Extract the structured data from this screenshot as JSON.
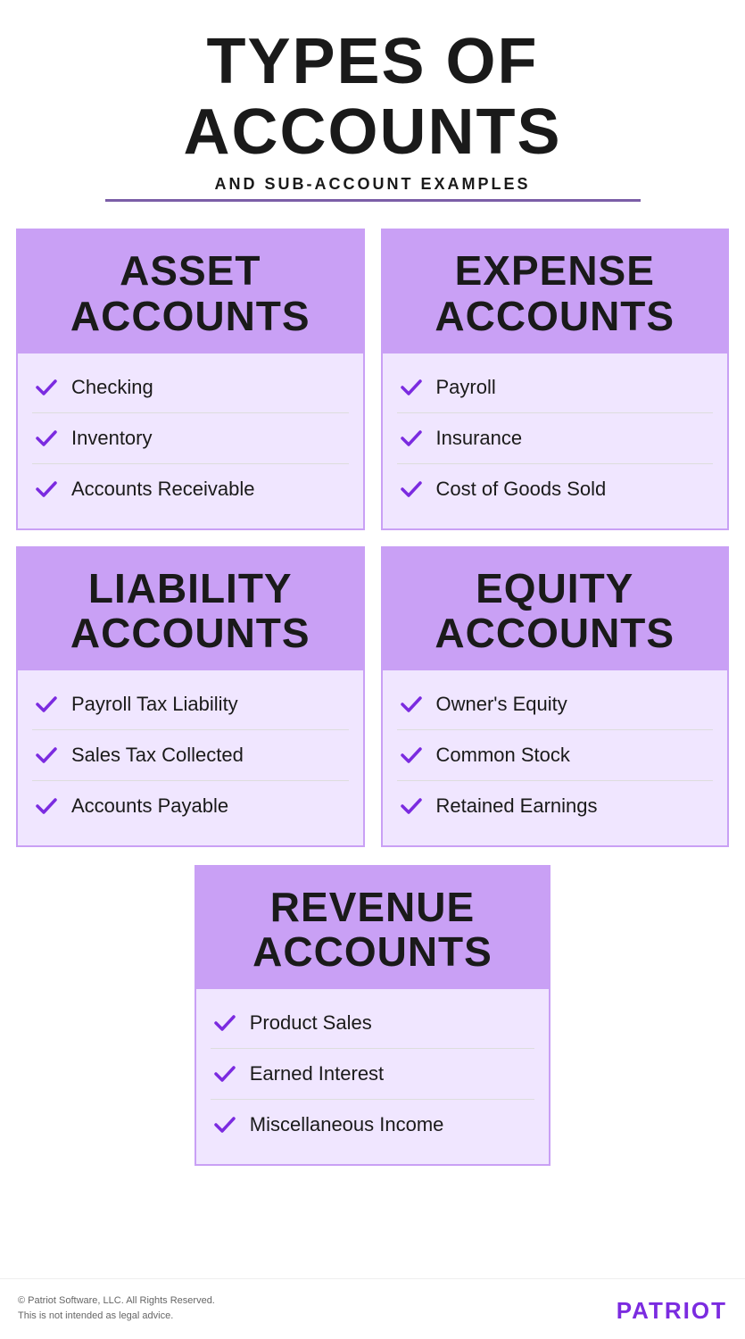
{
  "header": {
    "main_title": "TYPES OF ACCOUNTS",
    "subtitle": "AND SUB-ACCOUNT EXAMPLES"
  },
  "cards": [
    {
      "id": "asset",
      "title": "ASSET\nACCOUNTS",
      "items": [
        "Checking",
        "Inventory",
        "Accounts Receivable"
      ]
    },
    {
      "id": "expense",
      "title": "EXPENSE\nACCOUNTS",
      "items": [
        "Payroll",
        "Insurance",
        "Cost of Goods Sold"
      ]
    },
    {
      "id": "liability",
      "title": "LIABILITY\nACCOUNTS",
      "items": [
        "Payroll Tax Liability",
        "Sales Tax Collected",
        "Accounts Payable"
      ]
    },
    {
      "id": "equity",
      "title": "EQUITY\nACCOUNTS",
      "items": [
        "Owner's Equity",
        "Common Stock",
        "Retained Earnings"
      ]
    }
  ],
  "revenue_card": {
    "id": "revenue",
    "title": "REVENUE\nACCOUNTS",
    "items": [
      "Product Sales",
      "Earned Interest",
      "Miscellaneous Income"
    ]
  },
  "footer": {
    "copyright": "© Patriot Software, LLC. All Rights Reserved.\nThis is not intended as legal advice.",
    "brand": "PATRIOT"
  }
}
